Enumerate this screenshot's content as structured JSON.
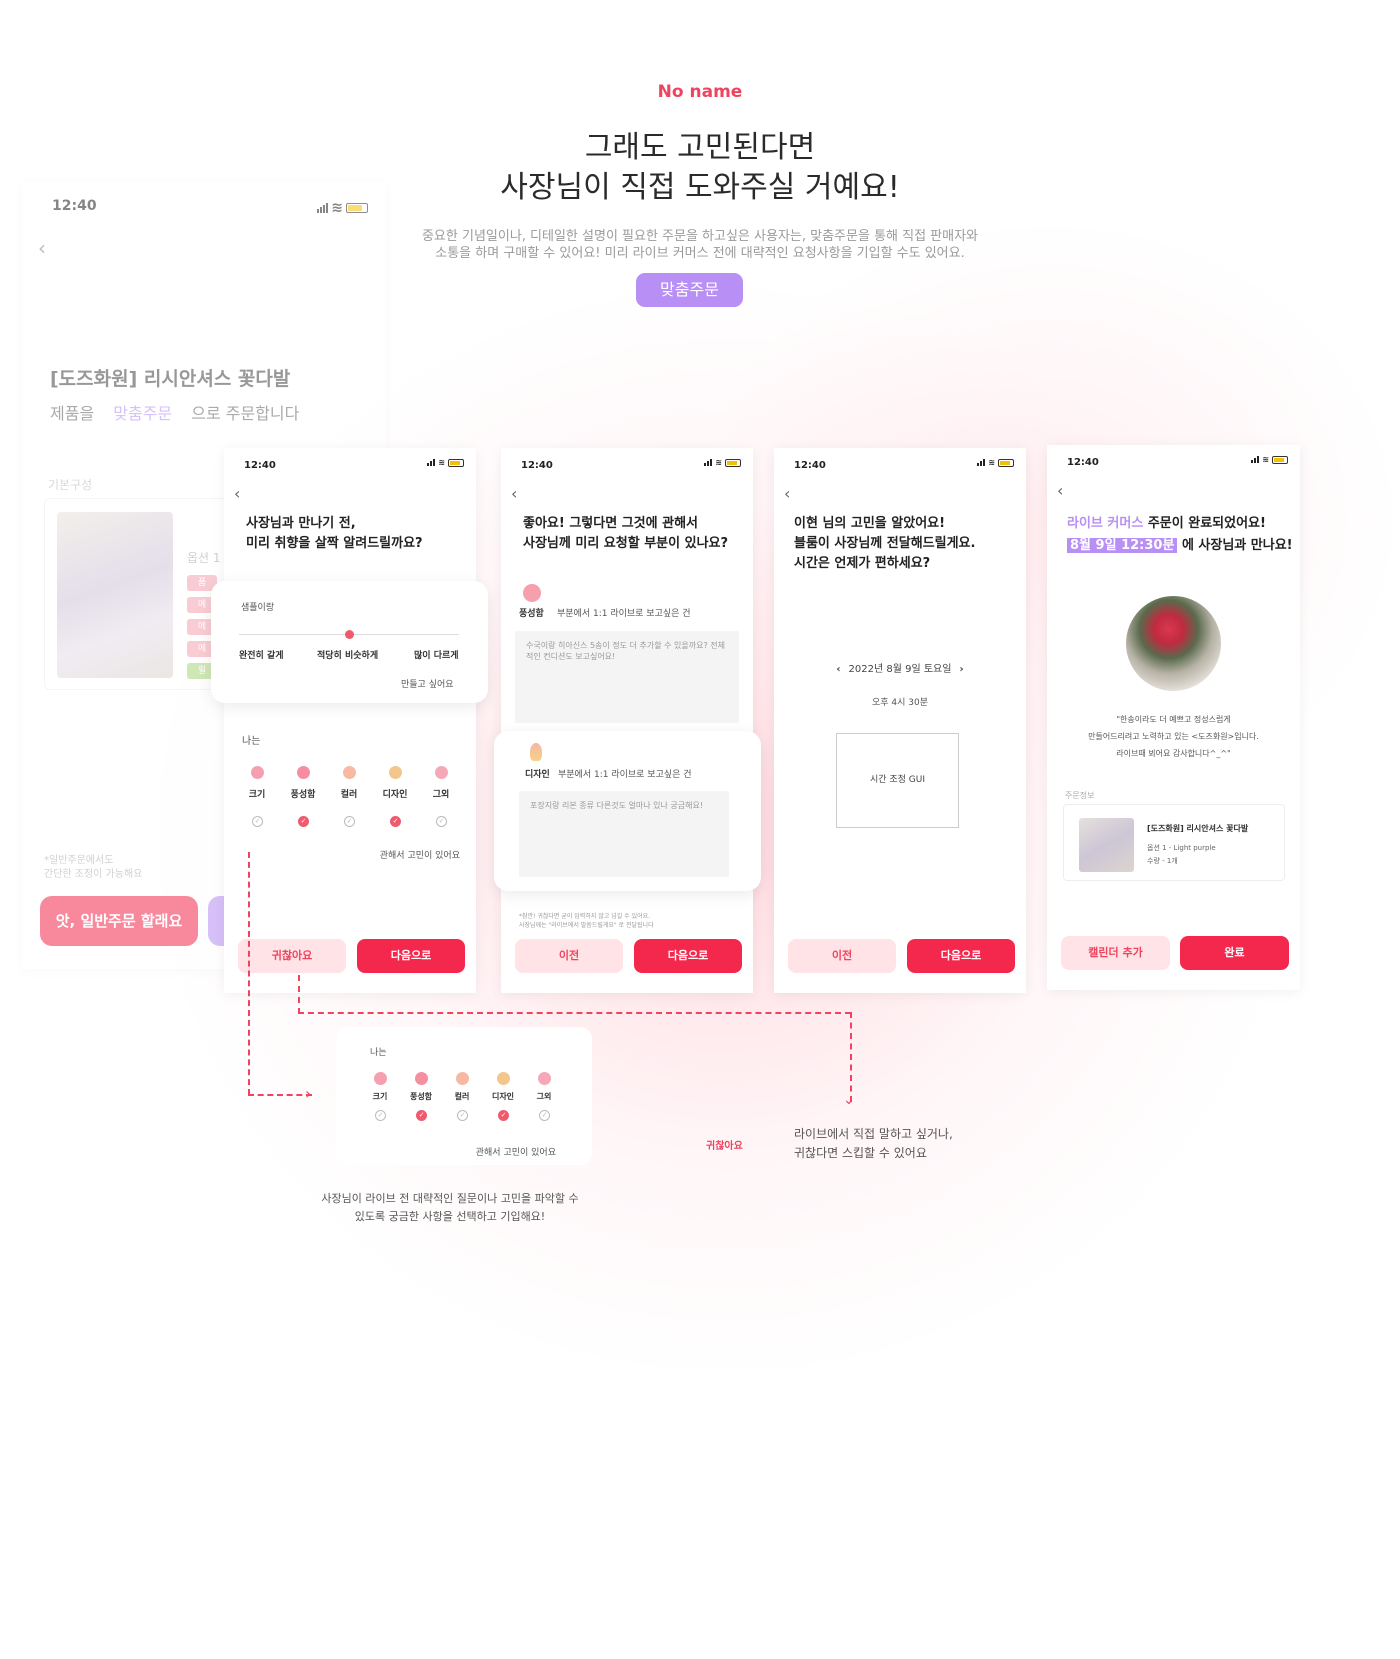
{
  "header": {
    "brand": "No name",
    "title_line1": "그래도 고민된다면",
    "title_line2": "사장님이 직접 도와주실 거예요!",
    "desc_line1": "중요한 기념일이나, 디테일한 설명이 필요한 주문을 하고싶은 사용자는, 맞춤주문을 통해 직접 판매자와",
    "desc_line2": "소통을 하며 구매할 수 있어요! 미리 라이브 커머스 전에 대략적인 요청사항을 기입할 수도 있어요.",
    "badge": "맞춤주문"
  },
  "status_time": "12:40",
  "colors": {
    "accent": "#f4284d",
    "purple": "#b88ff5",
    "pale": "#ffe3e6"
  },
  "bg_screen": {
    "title": "[도즈화원] 리시안셔스 꽃다발",
    "sub_pre": "제품을",
    "sub_hl": "맞춤주문",
    "sub_post": "으로 주문합니다",
    "section": "기본구성",
    "option": "옵션 1 -",
    "tags": [
      "품",
      "메",
      "메",
      "메",
      "필"
    ],
    "note_line1": "*일반주문에서도",
    "note_line2": "간단한 조정이 가능해요",
    "normal_btn": "앗, 일반주문 할래요"
  },
  "screen1": {
    "q_line1": "사장님과 만나기 전,",
    "q_line2": "미리 취향을 살짝 알려드릴까요?",
    "slider_title": "샘플이랑",
    "slider_left": "완전히 같게",
    "slider_mid": "적당히 비슷하게",
    "slider_right": "많이 다르게",
    "slider_value": 0.5,
    "slider_note": "만들고 싶어요",
    "me_label": "나는",
    "categories": [
      "크기",
      "풍성함",
      "컬러",
      "디자인",
      "그외"
    ],
    "checked": [
      false,
      true,
      false,
      true,
      false
    ],
    "worry_note": "관해서 고민이 있어요",
    "skip_btn": "귀찮아요",
    "next_btn": "다음으로"
  },
  "screen2": {
    "q_line1": "좋아요! 그렇다면 그것에 관해서",
    "q_line2": "사장님께 미리 요청할 부분이 있나요?",
    "item1_label": "풍성함",
    "item1_note": "부분에서 1:1 라이브로 보고싶은 건",
    "item1_text": "수국이랑 히아신스 5송이 정도 더 추가할 수 있을까요? 전체적인 컨디션도 보고싶어요!",
    "item2_label": "디자인",
    "item2_note": "부분에서 1:1 라이브로 보고싶은 건",
    "item2_text": "포장지랑 리본 종류 다른것도 얼마나 있나 궁금해요!",
    "footnote_line1": "*참깐! 귀찮다면 굳이 입력하지 않고 넘길 수 있어요.",
    "footnote_line2": "사장님께는 \"라이브에서 말씀드릴게요\" 로 전달됩니다",
    "prev_btn": "이전",
    "next_btn": "다음으로"
  },
  "screen3": {
    "q_line1": "이현 님의 고민을 알았어요!",
    "q_line2": "블룸이 사장님께 전달해드릴게요.",
    "q_line3": "시간은 언제가 편하세요?",
    "date": "2022년 8월 9일 토요일",
    "time": "오후 4시 30분",
    "gui_label": "시간 조정 GUI",
    "prev_btn": "이전",
    "next_btn": "다음으로"
  },
  "screen4": {
    "title_hl": "라이브 커머스",
    "title_rest": "주문이 완료되었어요!",
    "date_hl": "8월 9일 12:30분",
    "date_rest": "에 사장님과 만나요!",
    "quote_line1": "\"한송이라도 더 예쁘고 정성스럽게",
    "quote_line2": "만들어드리려고 노력하고 있는 <도즈화원>입니다.",
    "quote_line3": "라이브때 뵈어요 감사합니다^_^\"",
    "order_label": "주문정보",
    "product": "[도즈화원] 리시안셔스 꽃다발",
    "option": "옵션 1 - Light purple",
    "qty": "수량 - 1개",
    "calendar_btn": "캘린더 추가",
    "done_btn": "완료"
  },
  "annotations": {
    "card_me": "나는",
    "card_categories": [
      "크기",
      "풍성함",
      "컬러",
      "디자인",
      "그외"
    ],
    "card_checked": [
      false,
      true,
      false,
      true,
      false
    ],
    "card_note": "관해서 고민이 있어요",
    "caption_line1": "사장님이 라이브 전 대략적인 질문이나 고민을 파악할 수",
    "caption_line2": "있도록 궁금한 사항을 선택하고 기입해요!",
    "skip_label": "귀찮아요",
    "skip_desc_line1": "라이브에서 직접 말하고 싶거나,",
    "skip_desc_line2": "귀찮다면 스킵할 수 있어요"
  }
}
